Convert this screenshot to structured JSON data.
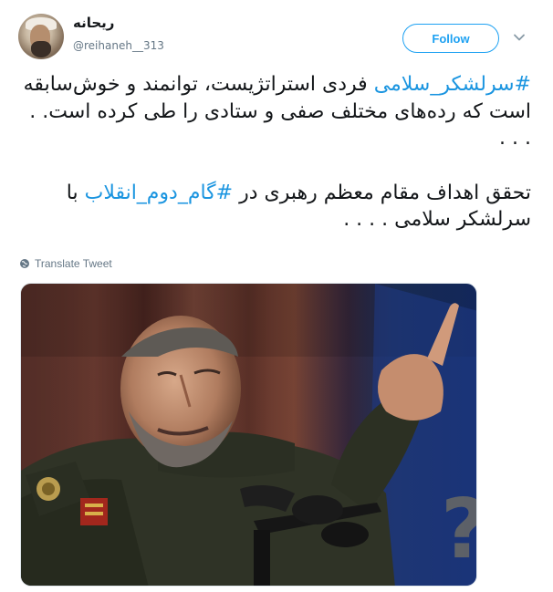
{
  "user": {
    "display_name": "ریحانه",
    "screen_name": "@reihaneh__313"
  },
  "follow_button": {
    "label": "Follow"
  },
  "tweet": {
    "paragraph1_hashtag": "#سرلشکر_سلامی",
    "paragraph1_text": " فردی استراتژیست، توانمند و خوش‌سابقه است که رده‌های مختلف صفی و ستادی را طی کرده است. . . . .",
    "paragraph2_before": "تحقق اهداف مقام معظم رهبری در ",
    "paragraph2_hashtag": "#گام_دوم_انقلاب",
    "paragraph2_after": " با سرلشکر سلامی . . . ."
  },
  "translate": {
    "label": "Translate Tweet"
  },
  "colors": {
    "accent": "#1da1f2",
    "hashtag": "#1b95e0",
    "secondary_text": "#657786"
  },
  "icons": {
    "caret": "chevron-down-icon",
    "translate": "globe-icon"
  }
}
